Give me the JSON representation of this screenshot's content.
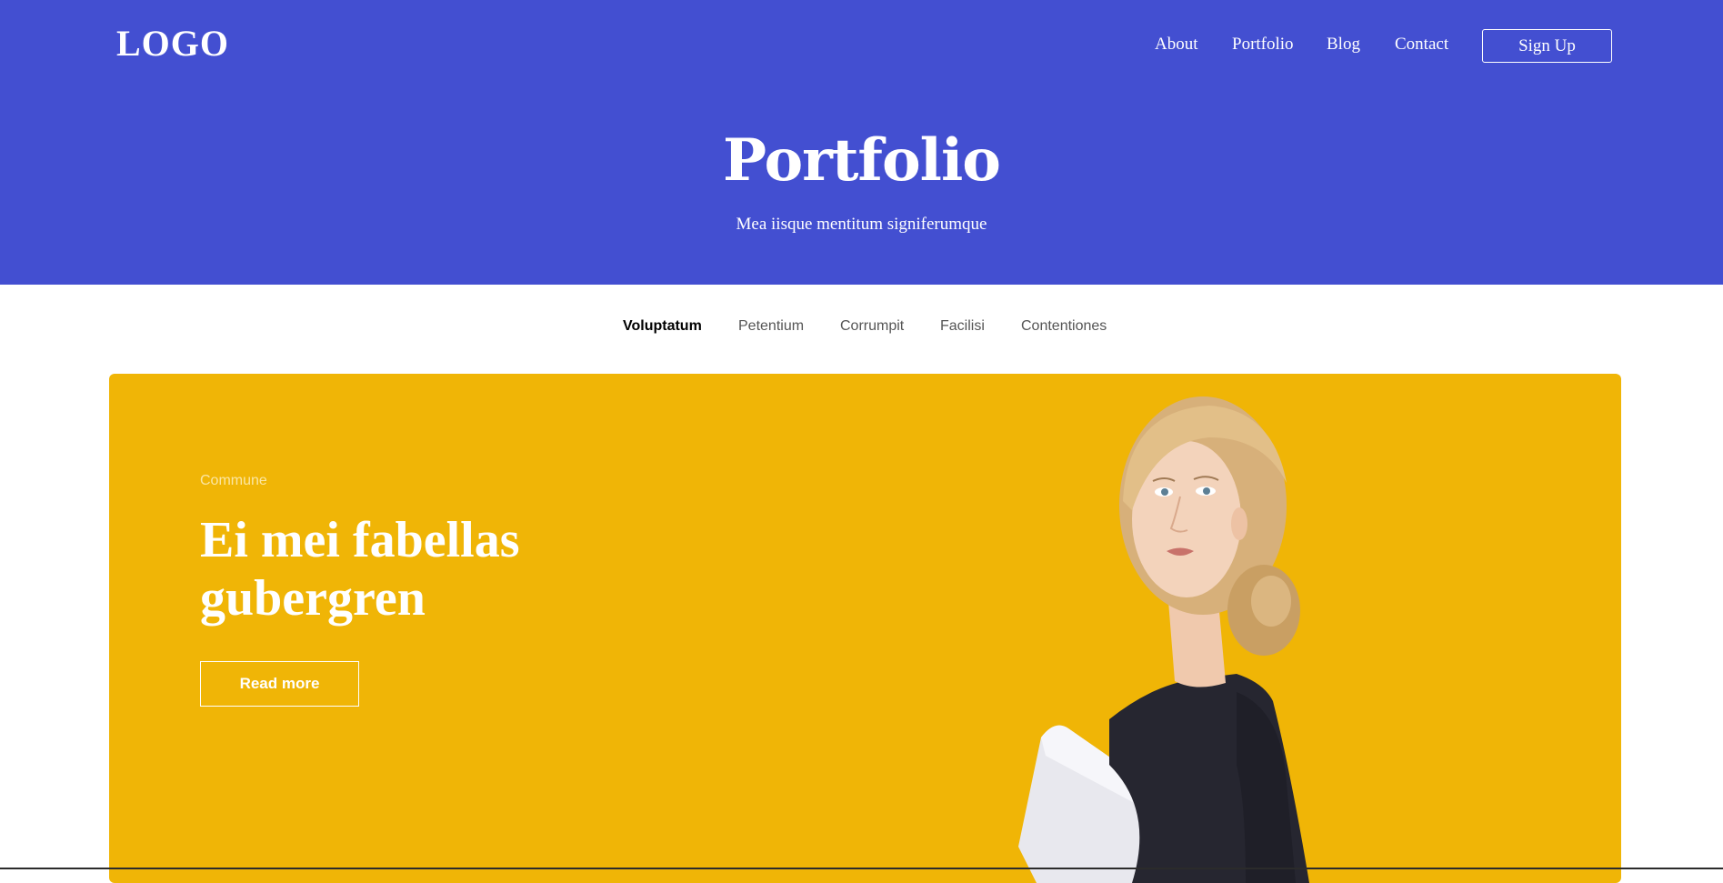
{
  "header": {
    "logo": "LOGO",
    "nav": [
      {
        "label": "About"
      },
      {
        "label": "Portfolio"
      },
      {
        "label": "Blog"
      },
      {
        "label": "Contact"
      }
    ],
    "signup_label": "Sign Up",
    "title": "Portfolio",
    "subtitle": "Mea iisque mentitum signiferumque",
    "background_color": "#434fd1"
  },
  "filters": {
    "items": [
      {
        "label": "Voluptatum",
        "active": true
      },
      {
        "label": "Petentium",
        "active": false
      },
      {
        "label": "Corrumpit",
        "active": false
      },
      {
        "label": "Facilisi",
        "active": false
      },
      {
        "label": "Contentiones",
        "active": false
      }
    ]
  },
  "featured": {
    "tag": "Commune",
    "title": "Ei mei fabellas gubergren",
    "button_label": "Read more",
    "background_color": "#f0b506",
    "image": "woman-portrait-with-laptop"
  }
}
